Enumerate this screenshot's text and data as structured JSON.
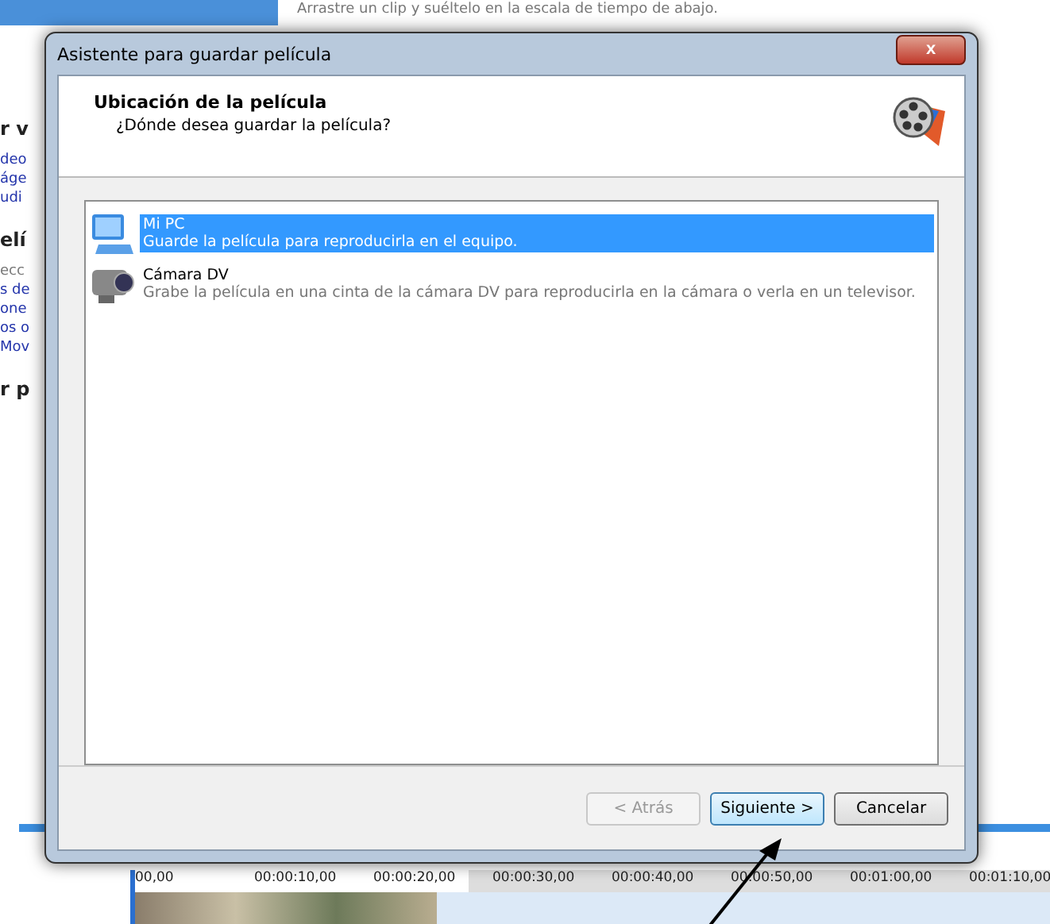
{
  "background": {
    "hint": "Arrastre un clip y suéltelo en la escala de tiempo de abajo.",
    "sidebar": [
      {
        "kind": "heading",
        "text": "r v"
      },
      {
        "kind": "link",
        "text": "deo"
      },
      {
        "kind": "link",
        "text": "áge"
      },
      {
        "kind": "link",
        "text": "udi"
      },
      {
        "kind": "heading",
        "text": "elí"
      },
      {
        "kind": "plain",
        "text": "ecc"
      },
      {
        "kind": "link",
        "text": "s de"
      },
      {
        "kind": "link",
        "text": "one"
      },
      {
        "kind": "link",
        "text": "os o"
      },
      {
        "kind": "link",
        "text": "Mov"
      },
      {
        "kind": "heading",
        "text": "r p"
      }
    ],
    "timeline": {
      "ticks": [
        "00,00",
        "00:00:10,00",
        "00:00:20,00",
        "00:00:30,00",
        "00:00:40,00",
        "00:00:50,00",
        "00:01:00,00",
        "00:01:10,00"
      ]
    }
  },
  "dialog": {
    "title": "Asistente para guardar película",
    "close_label": "x",
    "header_title": "Ubicación de la película",
    "header_subtitle": "¿Dónde desea guardar la película?",
    "options": [
      {
        "kind": "computer",
        "title": "Mi PC",
        "description": "Guarde la película para reproducirla en el equipo.",
        "selected": true
      },
      {
        "kind": "camera",
        "title": "Cámara DV",
        "description": "Grabe la película en una cinta de la cámara DV para reproducirla en la cámara o verla en un televisor.",
        "selected": false
      }
    ],
    "buttons": [
      {
        "label": "< Atrás",
        "disabled": true,
        "focused": false
      },
      {
        "label": "Siguiente >",
        "disabled": false,
        "focused": true
      },
      {
        "label": "Cancelar",
        "disabled": false,
        "focused": false
      }
    ]
  }
}
